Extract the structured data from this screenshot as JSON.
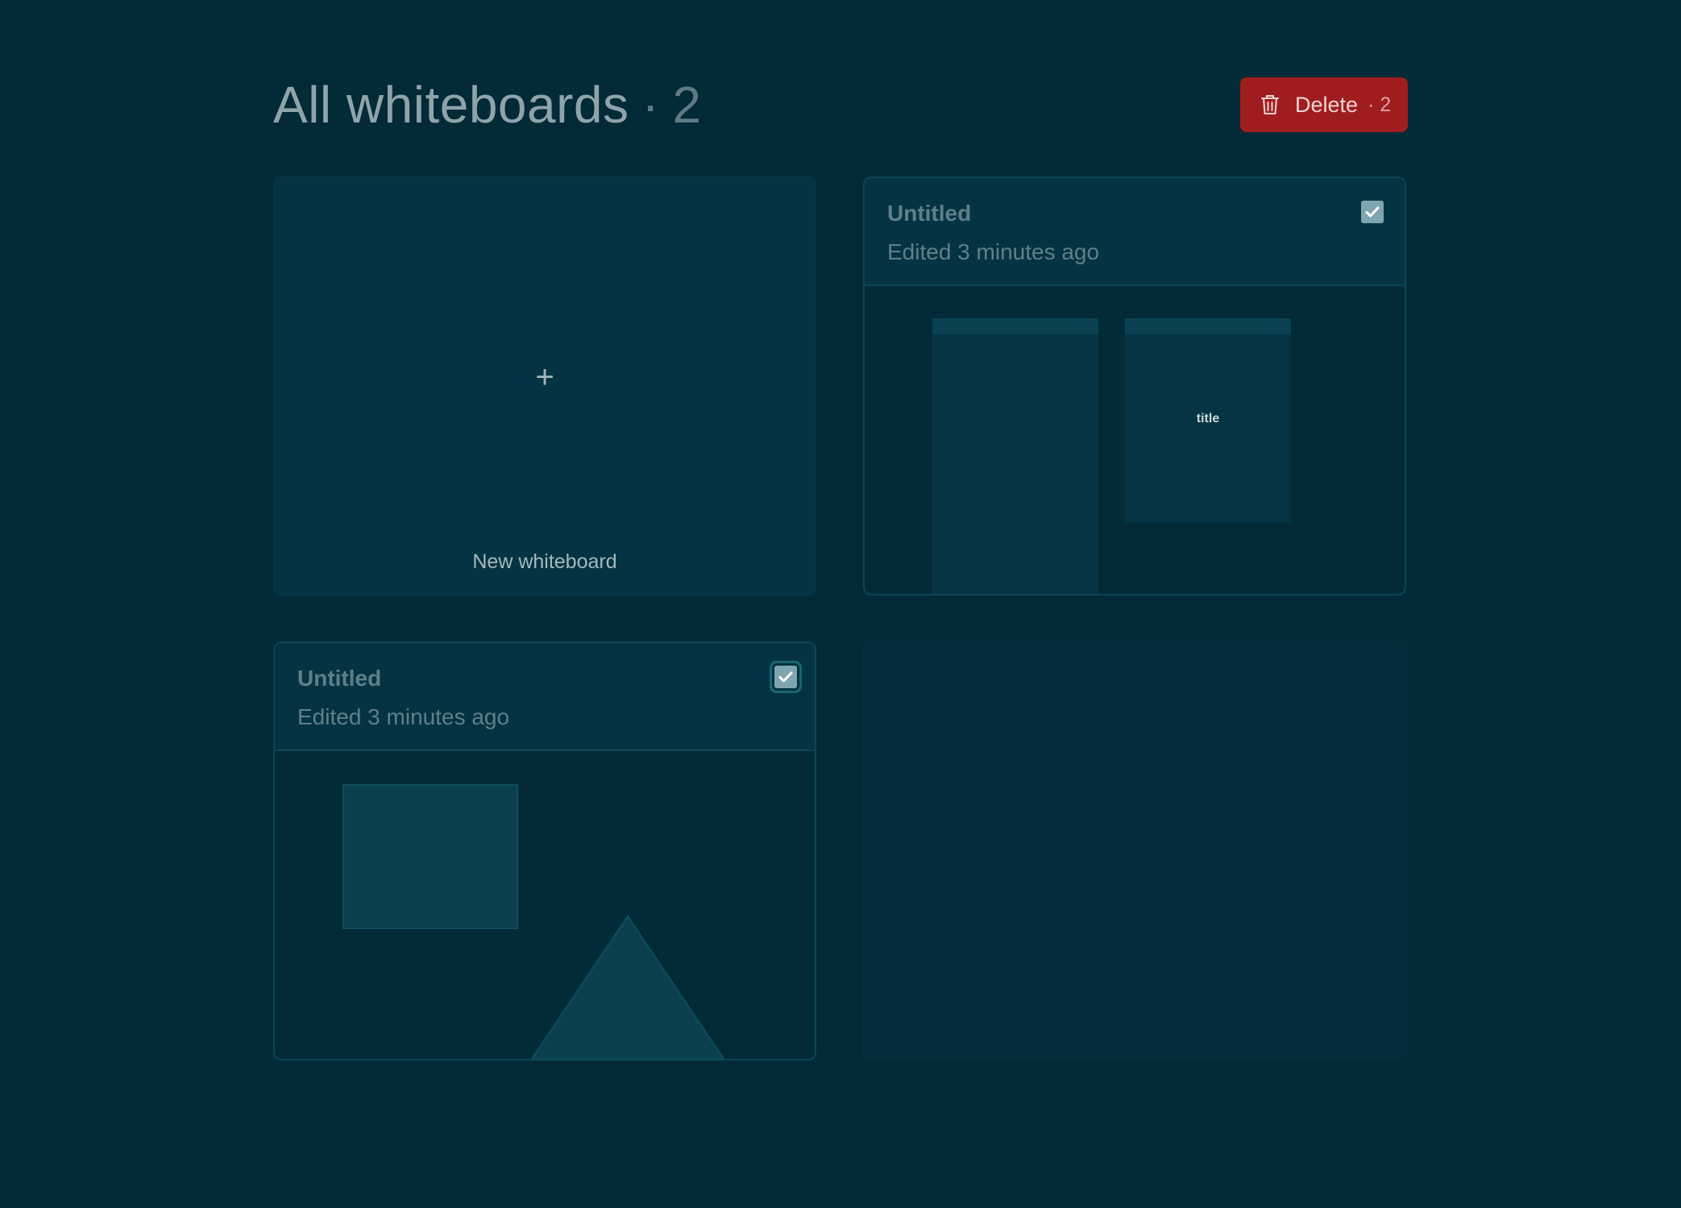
{
  "header": {
    "title": "All whiteboards",
    "separator": "·",
    "count": "2"
  },
  "toolbar": {
    "delete_label": "Delete",
    "delete_count": "· 2"
  },
  "new_card": {
    "plus": "+",
    "label": "New whiteboard"
  },
  "boards": [
    {
      "name": "Untitled",
      "edited": "Edited 3 minutes ago",
      "checked": true,
      "preview": {
        "column_titles": [
          "",
          "title"
        ]
      }
    },
    {
      "name": "Untitled",
      "edited": "Edited 3 minutes ago",
      "checked": true,
      "preview": {
        "shapes": [
          "square",
          "triangle"
        ]
      }
    }
  ],
  "colors": {
    "background": "#022a37",
    "card": "#043443",
    "danger": "#a01d1f",
    "checkbox": "#7fa6b0"
  }
}
